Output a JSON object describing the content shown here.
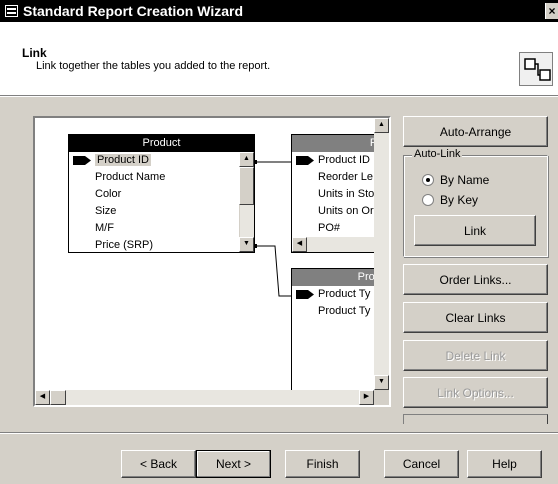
{
  "window": {
    "title": "Standard Report Creation Wizard",
    "close_glyph": "×"
  },
  "header": {
    "title": "Link",
    "subtitle": "Link together the tables you added to the report.",
    "icon": "link-tables-icon"
  },
  "tables": [
    {
      "title": "Product",
      "fields": [
        "Product ID",
        "Product Name",
        "Color",
        "Size",
        "M/F",
        "Price (SRP)"
      ]
    },
    {
      "title": "Pur",
      "fields": [
        "Product ID",
        "Reorder Le",
        "Units in Sto",
        "Units on Or",
        "PO#"
      ]
    },
    {
      "title": "Produ",
      "fields": [
        "Product Ty",
        "Product Ty"
      ]
    }
  ],
  "side_buttons": {
    "auto_arrange": "Auto-Arrange",
    "auto_link_legend": "Auto-Link",
    "by_name": "By Name",
    "by_key": "By Key",
    "link": "Link",
    "order_links": "Order Links...",
    "clear_links": "Clear Links",
    "delete_link": "Delete Link",
    "link_options": "Link Options..."
  },
  "auto_link_selected": "By Name",
  "footer": {
    "back": "< Back",
    "next": "Next >",
    "finish": "Finish",
    "cancel": "Cancel",
    "help": "Help"
  },
  "colors": {
    "title_bg": "#000000",
    "face": "#d4d0c8",
    "inactive_header": "#808080"
  }
}
